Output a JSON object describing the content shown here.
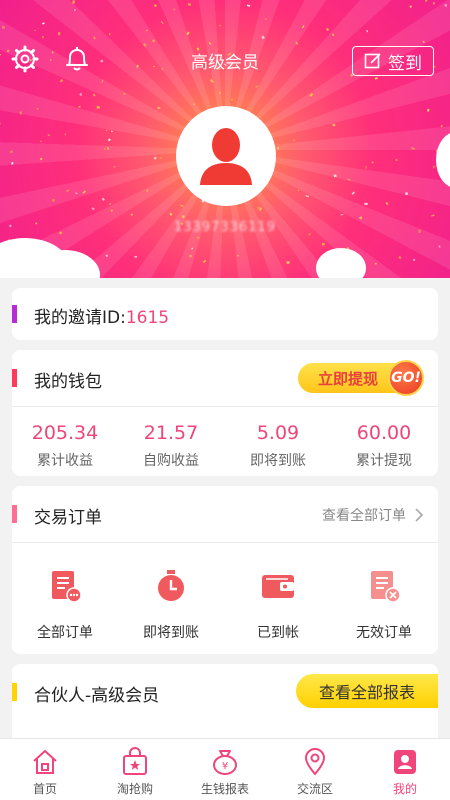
{
  "header": {
    "title": "高级会员",
    "checkin_label": "签到",
    "phone": "13397336119"
  },
  "invite": {
    "label": "我的邀请ID:",
    "code": "1615"
  },
  "wallet": {
    "title": "我的钱包",
    "withdraw_label": "立即提现",
    "go_label": "GO!",
    "stats": [
      {
        "value": "205.34",
        "label": "累计收益"
      },
      {
        "value": "21.57",
        "label": "自购收益"
      },
      {
        "value": "5.09",
        "label": "即将到账"
      },
      {
        "value": "60.00",
        "label": "累计提现"
      }
    ]
  },
  "orders": {
    "title": "交易订单",
    "view_all": "查看全部订单",
    "items": [
      {
        "label": "全部订单",
        "icon": "all-orders-icon"
      },
      {
        "label": "即将到账",
        "icon": "timer-icon"
      },
      {
        "label": "已到帐",
        "icon": "wallet-icon"
      },
      {
        "label": "无效订单",
        "icon": "invalid-order-icon"
      }
    ]
  },
  "partner": {
    "title": "合伙人-高级会员",
    "report_label": "查看全部报表"
  },
  "tabbar": {
    "items": [
      {
        "label": "首页",
        "icon": "home-icon"
      },
      {
        "label": "淘抢购",
        "icon": "flash-sale-icon"
      },
      {
        "label": "生钱报表",
        "icon": "money-bag-icon"
      },
      {
        "label": "交流区",
        "icon": "location-pin-icon"
      },
      {
        "label": "我的",
        "icon": "profile-icon"
      }
    ],
    "active_index": 4
  },
  "colors": {
    "accent": "#f0457a",
    "header_pink": "#f1208c",
    "header_orange": "#ff9a3c",
    "yellow": "#ffd000"
  }
}
